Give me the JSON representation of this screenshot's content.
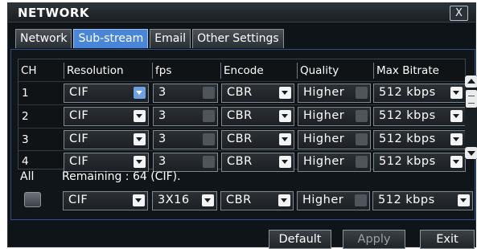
{
  "window": {
    "title": "NETWORK",
    "close_label": "X"
  },
  "tabs": [
    "Network",
    "Sub-stream",
    "Email",
    "Other Settings"
  ],
  "active_tab": "Sub-stream",
  "columns": [
    "CH",
    "Resolution",
    "fps",
    "Encode",
    "Quality",
    "Max Bitrate"
  ],
  "rows": [
    {
      "ch": "1",
      "resolution": "CIF",
      "fps": "3",
      "encode": "CBR",
      "quality": "Higher",
      "bitrate": "512 kbps"
    },
    {
      "ch": "2",
      "resolution": "CIF",
      "fps": "3",
      "encode": "CBR",
      "quality": "Higher",
      "bitrate": "512 kbps"
    },
    {
      "ch": "3",
      "resolution": "CIF",
      "fps": "3",
      "encode": "CBR",
      "quality": "Higher",
      "bitrate": "512 kbps"
    },
    {
      "ch": "4",
      "resolution": "CIF",
      "fps": "3",
      "encode": "CBR",
      "quality": "Higher",
      "bitrate": "512 kbps"
    }
  ],
  "all_row": {
    "label": "All",
    "remaining": "Remaining : 64 (CIF).",
    "resolution": "CIF",
    "fps": "3X16",
    "encode": "CBR",
    "quality": "Higher",
    "bitrate": "512 kbps"
  },
  "buttons": {
    "default": "Default",
    "apply": "Apply",
    "exit": "Exit"
  },
  "colors": {
    "accent": "#4a86d8",
    "panel_border": "#2d4f8d",
    "background": "#0f1418"
  }
}
